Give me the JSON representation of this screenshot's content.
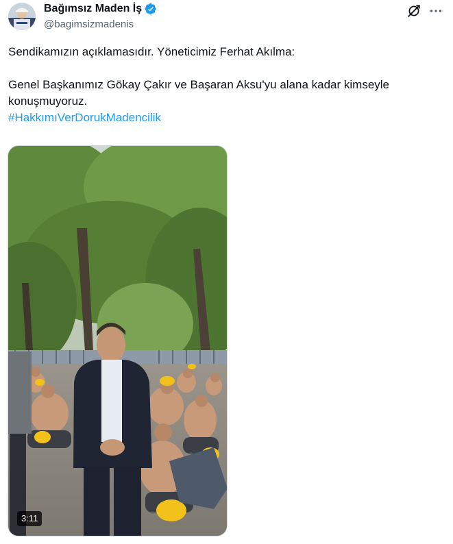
{
  "author": {
    "display_name": "Bağımsız Maden İş",
    "handle": "@bagimsizmadenis",
    "verified_color": "#1d9bf0"
  },
  "tweet": {
    "lines": [
      "Sendikamızın açıklamasıdır. Yöneticimiz Ferhat Akılma:",
      "Genel Başkanımız Gökay Çakır ve Başaran Aksu'yu alana kadar kimseyle konuşmuyoruz."
    ],
    "hashtag": "#HakkımıVerDorukMadencilik"
  },
  "media": {
    "type": "video",
    "duration": "3:11"
  },
  "icons": {
    "grok": "grok-icon",
    "more": "more-icon",
    "verified": "verified-badge-icon"
  },
  "colors": {
    "text": "#0f1419",
    "secondary": "#536471",
    "link": "#1d9bf0"
  }
}
